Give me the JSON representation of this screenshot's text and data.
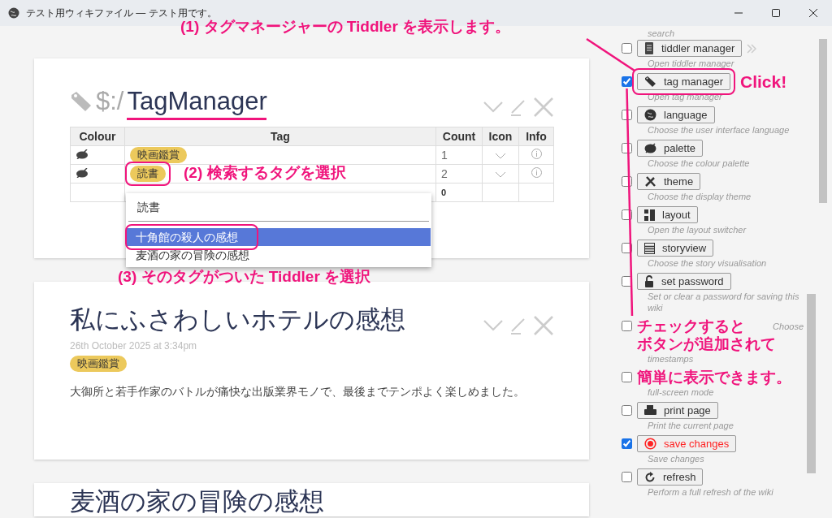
{
  "window": {
    "title": "テスト用ウィキファイル — テスト用です。"
  },
  "story": [
    {
      "kind": "tagmanager",
      "title_prefix": "$:/",
      "title": "TagManager",
      "columns": [
        "Colour",
        "Tag",
        "Count",
        "Icon",
        "Info"
      ],
      "rows": [
        {
          "tag": "映画鑑賞",
          "count": "1"
        },
        {
          "tag": "読書",
          "count": "2"
        }
      ],
      "new_row_count": "0",
      "dropdown": {
        "value": "読書",
        "items": [
          {
            "label": "十角館の殺人の感想",
            "selected": true
          },
          {
            "label": "麦酒の家の冒険の感想",
            "selected": false
          }
        ]
      }
    },
    {
      "kind": "note",
      "title": "私にふさわしいホテルの感想",
      "date": "26th October 2025 at 3:34pm",
      "tags": [
        "映画鑑賞"
      ],
      "body": "大御所と若手作家のバトルが痛快な出版業界モノで、最後までテンポよく楽しめました。"
    },
    {
      "kind": "note",
      "title": "麦酒の家の冒険の感想"
    }
  ],
  "sidebar": {
    "top_text": "search",
    "items": [
      {
        "kind": "manager",
        "label": "tiddler manager",
        "checked": false,
        "description": "Open tiddler manager"
      },
      {
        "kind": "tag",
        "label": "tag manager",
        "checked": true,
        "description": "Open tag manager"
      },
      {
        "kind": "language",
        "label": "language",
        "checked": false,
        "description": "Choose the user interface language"
      },
      {
        "kind": "palette",
        "label": "palette",
        "checked": false,
        "description": "Choose the colour palette"
      },
      {
        "kind": "theme",
        "label": "theme",
        "checked": false,
        "description": "Choose the display theme"
      },
      {
        "kind": "layout",
        "label": "layout",
        "checked": false,
        "description": "Open the layout switcher"
      },
      {
        "kind": "storyview",
        "label": "storyview",
        "checked": false,
        "description": "Choose the story visualisation"
      },
      {
        "kind": "password",
        "label": "set password",
        "checked": false,
        "description": "Set or clear a password for saving this wiki"
      },
      {
        "kind": "timestamps",
        "checked": false,
        "description": "Choose",
        "description_tail": "timestamps"
      },
      {
        "kind": "fullscreen",
        "checked": false,
        "description_tail": "full-screen mode"
      },
      {
        "kind": "print",
        "label": "print page",
        "checked": false,
        "description": "Print the current page"
      },
      {
        "kind": "save",
        "label": "save changes",
        "checked": true,
        "description": "Save changes"
      },
      {
        "kind": "refresh",
        "label": "refresh",
        "checked": false,
        "description": "Perform a full refresh of the wiki"
      }
    ]
  },
  "annotations": {
    "step1": "(1) タグマネージャーの Tiddler を表示します。",
    "click": "Click!",
    "step2": "(2) 検索するタグを選択",
    "step3": "(3) そのタグがついた Tiddler を選択",
    "note_lines": [
      "チェックすると",
      "ボタンが追加されて",
      "簡単に表示できます。"
    ]
  }
}
